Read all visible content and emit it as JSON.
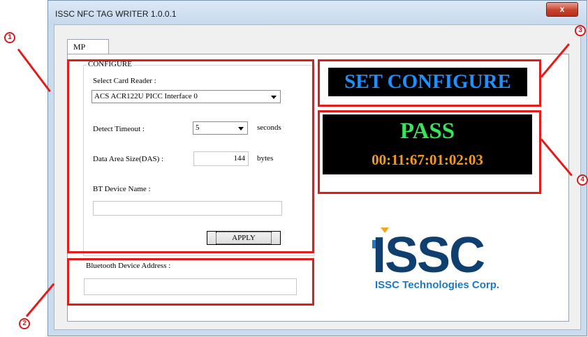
{
  "window": {
    "title": "ISSC NFC TAG WRITER 1.0.0.1",
    "close_glyph": "x"
  },
  "tabs": [
    {
      "label": "MP"
    }
  ],
  "configure": {
    "group_label": "CONFIGURE",
    "select_card_reader_label": "Select Card Reader :",
    "card_reader_value": "ACS ACR122U PICC Interface 0",
    "detect_timeout_label": "Detect Timeout :",
    "detect_timeout_value": "5",
    "detect_timeout_unit": "seconds",
    "das_label": "Data Area Size(DAS) :",
    "das_value": "144",
    "das_unit": "bytes",
    "bt_device_name_label": "BT Device Name :",
    "bt_device_name_value": "",
    "apply_label": "APPLY"
  },
  "bt_address": {
    "label": "Bluetooth Device Address :",
    "value": ""
  },
  "status": {
    "mode_text": "SET CONFIGURE",
    "result_text": "PASS",
    "address_text": "00:11:67:01:02:03",
    "colors": {
      "mode": "#1e90ff",
      "pass": "#38e45a",
      "address": "#f39a1e",
      "annotation": "#e21b1b"
    }
  },
  "logo": {
    "brand": "ISSC",
    "tagline": "ISSC Technologies Corp.",
    "colors": {
      "dark": "#0e3f6e",
      "light": "#1d79c4",
      "accent": "#f0a81c"
    }
  },
  "annotations": [
    "1",
    "2",
    "3",
    "4"
  ]
}
